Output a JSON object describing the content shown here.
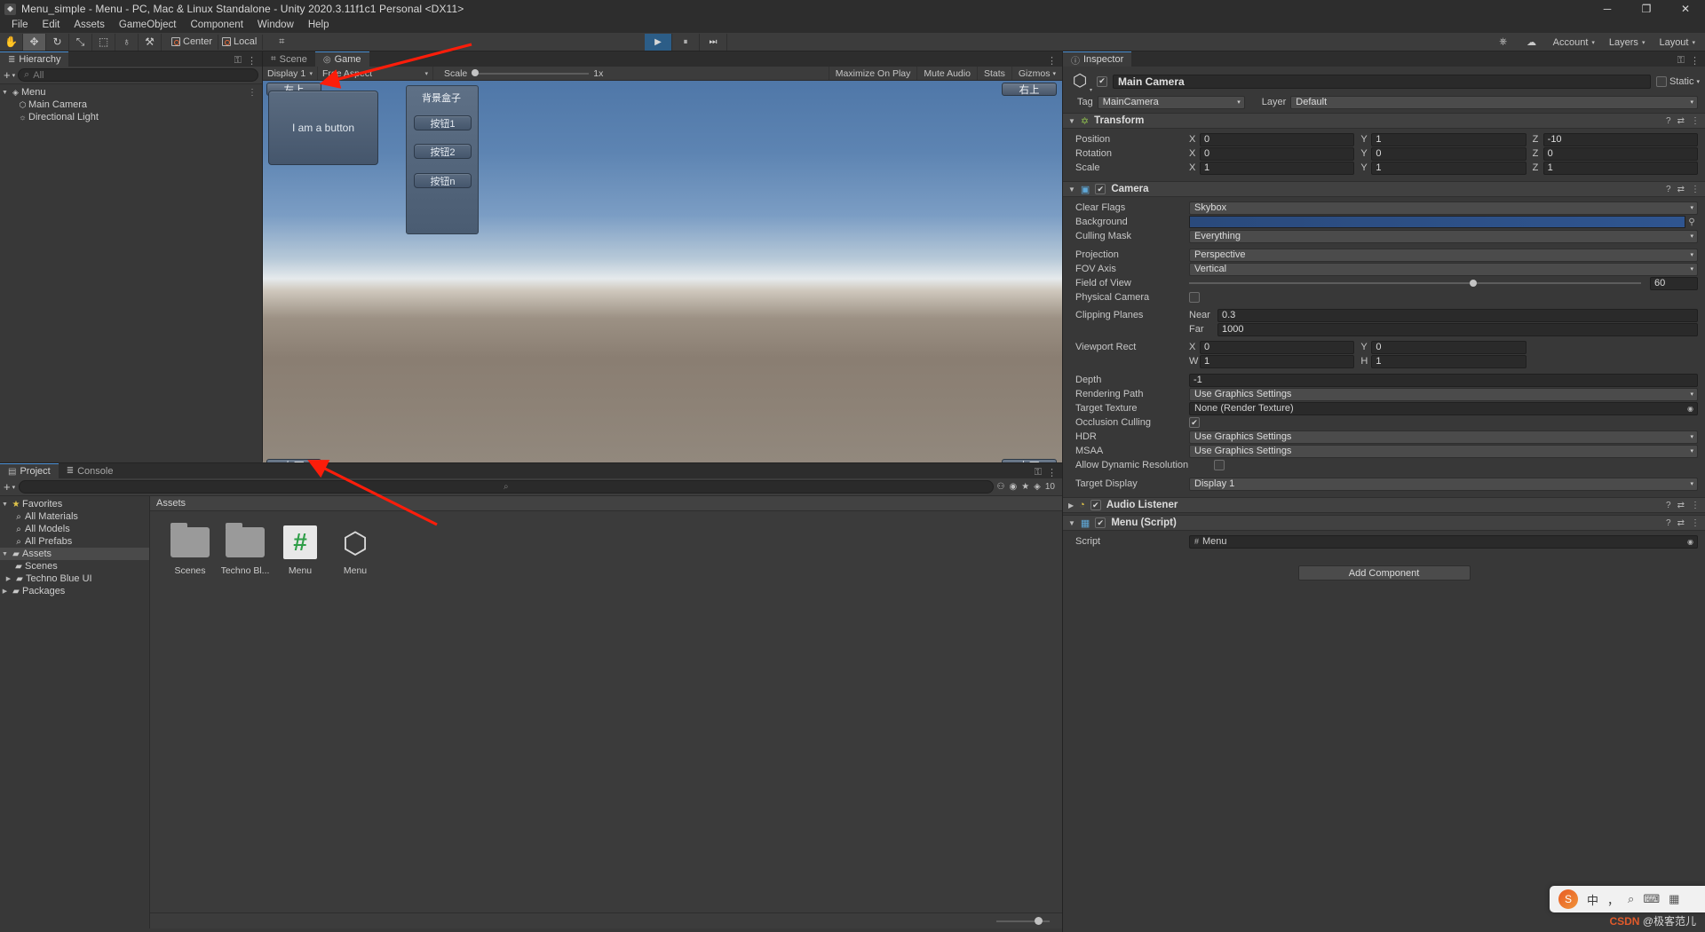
{
  "window": {
    "title": "Menu_simple - Menu - PC, Mac & Linux Standalone - Unity 2020.3.11f1c1 Personal <DX11>",
    "minimize": "─",
    "maximize": "❐",
    "close": "✕"
  },
  "menubar": [
    "File",
    "Edit",
    "Assets",
    "GameObject",
    "Component",
    "Window",
    "Help"
  ],
  "toolbar": {
    "tools": [
      {
        "name": "hand-tool",
        "glyph": "✋"
      },
      {
        "name": "move-tool",
        "glyph": "✥"
      },
      {
        "name": "rotate-tool",
        "glyph": "↻"
      },
      {
        "name": "scale-tool",
        "glyph": "⤡"
      },
      {
        "name": "rect-tool",
        "glyph": "⬚"
      },
      {
        "name": "transform-tool",
        "glyph": "♁"
      },
      {
        "name": "custom-tool",
        "glyph": "⚒"
      }
    ],
    "pivot": "Center",
    "handle": "Local",
    "grid_glyph": "⌗",
    "play": "▶",
    "pause": "⏸",
    "step": "⏭",
    "cloud": "☁",
    "account": "Account",
    "layers": "Layers",
    "layout": "Layout",
    "collab": "⎈"
  },
  "hierarchy": {
    "tab": "Hierarchy",
    "tab_icon": "≣",
    "add_label": "+",
    "search_placeholder": "All",
    "search_icon": "⌕",
    "items": [
      {
        "label": "Menu",
        "depth": 0,
        "twisty": "▼",
        "icon": "◈",
        "selected": false,
        "dots": "⋮"
      },
      {
        "label": "Main Camera",
        "depth": 1,
        "twisty": "",
        "icon": "⬡",
        "selected": false,
        "dots": ""
      },
      {
        "label": "Directional Light",
        "depth": 1,
        "twisty": "",
        "icon": "☼",
        "selected": false,
        "dots": ""
      }
    ]
  },
  "gameview": {
    "tabs": [
      {
        "label": "Scene",
        "icon": "⌗",
        "active": false
      },
      {
        "label": "Game",
        "icon": "◎",
        "active": true
      }
    ],
    "lock_icon": "⚿",
    "menu_icon": "⋮",
    "display": "Display 1",
    "aspect": "Free Aspect",
    "scale_label": "Scale",
    "scale_value": "1x",
    "maximize_on_play": "Maximize On Play",
    "mute_audio": "Mute Audio",
    "stats": "Stats",
    "gizmos": "Gizmos",
    "caret": "▾",
    "overlay": {
      "top_left_tag": "左上",
      "top_right_tag": "右上",
      "bottom_left_tag": "左下",
      "bottom_right_tag": "右下",
      "main_button": "I am a button",
      "panel_title": "背景盒子",
      "panel_buttons": [
        "按钮1",
        "按钮2",
        "按钮n"
      ]
    }
  },
  "project": {
    "tabs": [
      {
        "label": "Project",
        "icon": "▤",
        "active": true
      },
      {
        "label": "Console",
        "icon": "≣",
        "active": false
      }
    ],
    "add_label": "+",
    "search_icon": "⌕",
    "right_icons": [
      "⚇",
      "◉",
      "★"
    ],
    "count_icon": "◈",
    "count": "10",
    "tree": [
      {
        "label": "Favorites",
        "depth": 0,
        "twisty": "▼",
        "icon": "★",
        "icon_class": "star",
        "selected": false
      },
      {
        "label": "All Materials",
        "depth": 1,
        "twisty": "",
        "icon": "⌕",
        "icon_class": "",
        "selected": false
      },
      {
        "label": "All Models",
        "depth": 1,
        "twisty": "",
        "icon": "⌕",
        "icon_class": "",
        "selected": false
      },
      {
        "label": "All Prefabs",
        "depth": 1,
        "twisty": "",
        "icon": "⌕",
        "icon_class": "",
        "selected": false
      },
      {
        "label": "Assets",
        "depth": 0,
        "twisty": "▼",
        "icon": "▰",
        "icon_class": "folder",
        "selected": true
      },
      {
        "label": "Scenes",
        "depth": 1,
        "twisty": "",
        "icon": "▰",
        "icon_class": "folder",
        "selected": false
      },
      {
        "label": "Techno Blue UI",
        "depth": 1,
        "twisty": "▶",
        "icon": "▰",
        "icon_class": "folder",
        "selected": false
      },
      {
        "label": "Packages",
        "depth": 0,
        "twisty": "▶",
        "icon": "▰",
        "icon_class": "folder",
        "selected": false
      }
    ],
    "assets_header": "Assets",
    "assets": [
      {
        "label": "Scenes",
        "type": "folder"
      },
      {
        "label": "Techno Bl...",
        "type": "folder"
      },
      {
        "label": "Menu",
        "type": "csharp",
        "glyph": "#"
      },
      {
        "label": "Menu",
        "type": "unity",
        "glyph": "⬡"
      }
    ]
  },
  "inspector": {
    "tab": "Inspector",
    "tab_icon": "ⓘ",
    "lock_icon": "⚿",
    "menu_icon": "⋮",
    "object_name": "Main Camera",
    "static_label": "Static",
    "static_caret": "▾",
    "tag_label": "Tag",
    "tag_value": "MainCamera",
    "layer_label": "Layer",
    "layer_value": "Default",
    "components": [
      {
        "name": "Transform",
        "icon": "✡",
        "rows": [
          {
            "label": "Position",
            "type": "xyz",
            "x": "0",
            "y": "1",
            "z": "-10"
          },
          {
            "label": "Rotation",
            "type": "xyz",
            "x": "0",
            "y": "0",
            "z": "0"
          },
          {
            "label": "Scale",
            "type": "xyz",
            "x": "1",
            "y": "1",
            "z": "1"
          }
        ]
      },
      {
        "name": "Camera",
        "icon": "▣",
        "rows": [
          {
            "label": "Clear Flags",
            "type": "dropdown",
            "value": "Skybox"
          },
          {
            "label": "Background",
            "type": "color",
            "value": ""
          },
          {
            "label": "Culling Mask",
            "type": "dropdown",
            "value": "Everything"
          },
          {
            "label": "Projection",
            "type": "dropdown",
            "value": "Perspective"
          },
          {
            "label": "FOV Axis",
            "type": "dropdown",
            "value": "Vertical"
          },
          {
            "label": "Field of View",
            "type": "slider",
            "value": "60"
          },
          {
            "label": "Physical Camera",
            "type": "checkbox",
            "value": ""
          },
          {
            "label": "Clipping Planes",
            "type": "pair",
            "sub1": "Near",
            "v1": "0.3",
            "sub2": "Far",
            "v2": "1000"
          },
          {
            "label": "Viewport Rect",
            "type": "rect",
            "a1": "X",
            "v1": "0",
            "a2": "Y",
            "v2": "0",
            "a3": "W",
            "v3": "1",
            "a4": "H",
            "v4": "1"
          },
          {
            "label": "Depth",
            "type": "text",
            "value": "-1"
          },
          {
            "label": "Rendering Path",
            "type": "dropdown",
            "value": "Use Graphics Settings"
          },
          {
            "label": "Target Texture",
            "type": "dropdown",
            "value": "None (Render Texture)"
          },
          {
            "label": "Occlusion Culling",
            "type": "checkbox",
            "value": "✔"
          },
          {
            "label": "HDR",
            "type": "dropdown",
            "value": "Use Graphics Settings"
          },
          {
            "label": "MSAA",
            "type": "dropdown",
            "value": "Use Graphics Settings"
          },
          {
            "label": "Allow Dynamic Resolution",
            "type": "checkbox",
            "value": ""
          },
          {
            "label": "Target Display",
            "type": "dropdown",
            "value": "Display 1"
          }
        ]
      },
      {
        "name": "Audio Listener",
        "icon": "◔",
        "rows": []
      },
      {
        "name": "Menu (Script)",
        "icon": "▦",
        "rows": [
          {
            "label": "Script",
            "type": "object",
            "value": "Menu"
          }
        ]
      }
    ],
    "add_component": "Add Component"
  },
  "ime": {
    "logo": "S",
    "mode": "中",
    "punct": "，",
    "mic": "⌕",
    "kb": "⌨",
    "menu": "▦"
  },
  "watermark": {
    "brand": "CSDN",
    "text": "@极客范儿"
  }
}
